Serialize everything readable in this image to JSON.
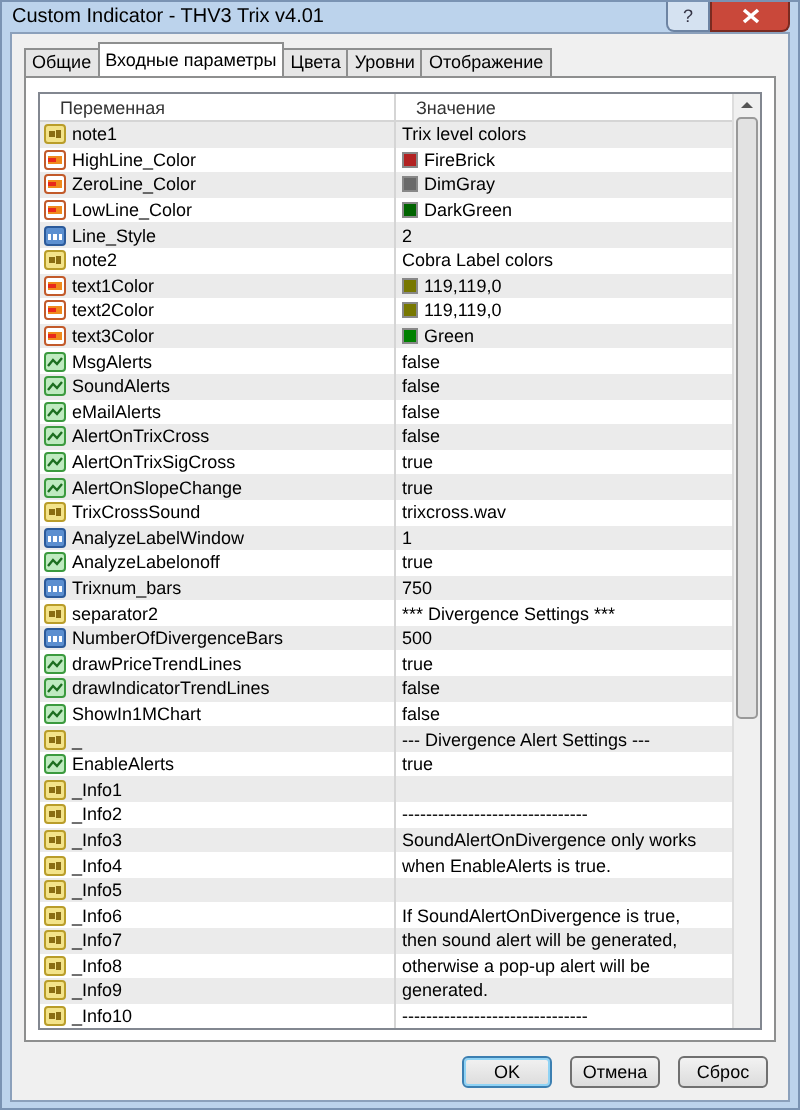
{
  "window": {
    "title": "Custom Indicator - THV3 Trix v4.01",
    "help_label": "?"
  },
  "tabs": [
    {
      "label": "Общие",
      "selected": false
    },
    {
      "label": "Входные параметры",
      "selected": true
    },
    {
      "label": "Цвета",
      "selected": false
    },
    {
      "label": "Уровни",
      "selected": false
    },
    {
      "label": "Отображение",
      "selected": false
    }
  ],
  "table": {
    "columns": [
      "Переменная",
      "Значение"
    ],
    "rows": [
      {
        "kind": "string",
        "name": "note1",
        "value": "Trix level colors"
      },
      {
        "kind": "color",
        "name": "HighLine_Color",
        "value": "FireBrick",
        "color": "#b22222"
      },
      {
        "kind": "color",
        "name": "ZeroLine_Color",
        "value": "DimGray",
        "color": "#696969"
      },
      {
        "kind": "color",
        "name": "LowLine_Color",
        "value": "DarkGreen",
        "color": "#006400"
      },
      {
        "kind": "int",
        "name": "Line_Style",
        "value": "2"
      },
      {
        "kind": "string",
        "name": "note2",
        "value": "Cobra Label colors"
      },
      {
        "kind": "color",
        "name": "text1Color",
        "value": "119,119,0",
        "color": "#777700"
      },
      {
        "kind": "color",
        "name": "text2Color",
        "value": "119,119,0",
        "color": "#777700"
      },
      {
        "kind": "color",
        "name": "text3Color",
        "value": "Green",
        "color": "#008000"
      },
      {
        "kind": "bool",
        "name": "MsgAlerts",
        "value": "false"
      },
      {
        "kind": "bool",
        "name": "SoundAlerts",
        "value": "false"
      },
      {
        "kind": "bool",
        "name": "eMailAlerts",
        "value": "false"
      },
      {
        "kind": "bool",
        "name": "AlertOnTrixCross",
        "value": "false"
      },
      {
        "kind": "bool",
        "name": "AlertOnTrixSigCross",
        "value": "true"
      },
      {
        "kind": "bool",
        "name": "AlertOnSlopeChange",
        "value": "true"
      },
      {
        "kind": "string",
        "name": "TrixCrossSound",
        "value": "trixcross.wav"
      },
      {
        "kind": "int",
        "name": "AnalyzeLabelWindow",
        "value": "1"
      },
      {
        "kind": "bool",
        "name": "AnalyzeLabelonoff",
        "value": "true"
      },
      {
        "kind": "int",
        "name": "Trixnum_bars",
        "value": "750"
      },
      {
        "kind": "string",
        "name": "separator2",
        "value": "*** Divergence Settings ***"
      },
      {
        "kind": "int",
        "name": "NumberOfDivergenceBars",
        "value": "500"
      },
      {
        "kind": "bool",
        "name": "drawPriceTrendLines",
        "value": "true"
      },
      {
        "kind": "bool",
        "name": "drawIndicatorTrendLines",
        "value": "false"
      },
      {
        "kind": "bool",
        "name": "ShowIn1MChart",
        "value": "false"
      },
      {
        "kind": "string",
        "name": "_",
        "value": "--- Divergence Alert Settings ---"
      },
      {
        "kind": "bool",
        "name": "EnableAlerts",
        "value": "true"
      },
      {
        "kind": "string",
        "name": "_Info1"
      },
      {
        "kind": "string",
        "name": "_Info2",
        "value": "-------------------------------"
      },
      {
        "kind": "string",
        "name": "_Info3",
        "value": "SoundAlertOnDivergence only works"
      },
      {
        "kind": "string",
        "name": "_Info4",
        "value": "when EnableAlerts is true."
      },
      {
        "kind": "string",
        "name": "_Info5"
      },
      {
        "kind": "string",
        "name": "_Info6",
        "value": "If SoundAlertOnDivergence is true,"
      },
      {
        "kind": "string",
        "name": "_Info7",
        "value": "then sound alert will be generated,"
      },
      {
        "kind": "string",
        "name": "_Info8",
        "value": "otherwise a pop-up alert will be"
      },
      {
        "kind": "string",
        "name": "_Info9",
        "value": "generated."
      },
      {
        "kind": "string",
        "name": "_Info10",
        "value": "-------------------------------"
      }
    ]
  },
  "buttons": [
    {
      "label": "OK",
      "default": true
    },
    {
      "label": "Отмена",
      "default": false
    },
    {
      "label": "Сброс",
      "default": false
    }
  ]
}
